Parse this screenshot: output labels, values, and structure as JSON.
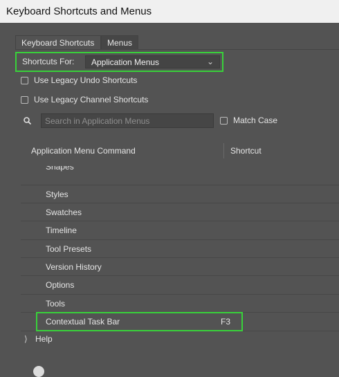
{
  "window": {
    "title": "Keyboard Shortcuts and Menus"
  },
  "tabs": [
    {
      "label": "Keyboard Shortcuts",
      "active": true
    },
    {
      "label": "Menus",
      "active": false
    }
  ],
  "shortcuts_for": {
    "label": "Shortcuts For:",
    "value": "Application Menus"
  },
  "options": {
    "legacy_undo": {
      "label": "Use Legacy Undo Shortcuts",
      "checked": false
    },
    "legacy_channel": {
      "label": "Use Legacy Channel Shortcuts",
      "checked": false
    },
    "match_case": {
      "label": "Match Case",
      "checked": false
    }
  },
  "search": {
    "placeholder": "Search in Application Menus",
    "value": ""
  },
  "columns": {
    "command": "Application Menu Command",
    "shortcut": "Shortcut"
  },
  "rows": [
    {
      "name": "Shapes",
      "shortcut": ""
    },
    {
      "name": "Styles",
      "shortcut": ""
    },
    {
      "name": "Swatches",
      "shortcut": ""
    },
    {
      "name": "Timeline",
      "shortcut": ""
    },
    {
      "name": "Tool Presets",
      "shortcut": ""
    },
    {
      "name": "Version History",
      "shortcut": ""
    },
    {
      "name": "Options",
      "shortcut": ""
    },
    {
      "name": "Tools",
      "shortcut": ""
    },
    {
      "name": "Contextual Task Bar",
      "shortcut": "F3"
    }
  ],
  "group": {
    "name": "Help",
    "expanded": false
  },
  "colors": {
    "highlight": "#38d23a",
    "background": "#535353"
  },
  "icons": {
    "search": "search-icon",
    "dropdown": "chevron-down-icon",
    "expander": "chevron-right-icon"
  }
}
